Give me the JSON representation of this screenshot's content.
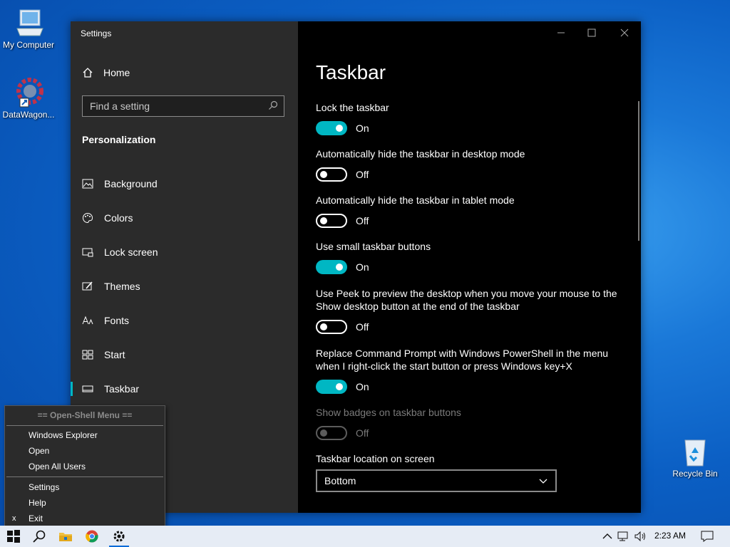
{
  "desktop": {
    "icons": [
      {
        "label": "My Computer",
        "icon": "computer-icon"
      },
      {
        "label": "DataWagon...",
        "icon": "gear-shortcut-icon"
      },
      {
        "label": "Recycle Bin",
        "icon": "recycle-bin-icon"
      }
    ]
  },
  "window": {
    "title": "Settings",
    "controls": [
      "minimize-icon",
      "maximize-icon",
      "close-icon"
    ]
  },
  "sidebar": {
    "home_label": "Home",
    "search_placeholder": "Find a setting",
    "section_title": "Personalization",
    "items": [
      {
        "label": "Background",
        "icon": "picture-icon"
      },
      {
        "label": "Colors",
        "icon": "palette-icon"
      },
      {
        "label": "Lock screen",
        "icon": "lock-screen-icon"
      },
      {
        "label": "Themes",
        "icon": "brush-icon"
      },
      {
        "label": "Fonts",
        "icon": "font-icon"
      },
      {
        "label": "Start",
        "icon": "start-grid-icon"
      },
      {
        "label": "Taskbar",
        "icon": "taskbar-icon",
        "active": true
      }
    ]
  },
  "content": {
    "title": "Taskbar",
    "settings": [
      {
        "label": "Lock the taskbar",
        "state": "On"
      },
      {
        "label": "Automatically hide the taskbar in desktop mode",
        "state": "Off"
      },
      {
        "label": "Automatically hide the taskbar in tablet mode",
        "state": "Off"
      },
      {
        "label": "Use small taskbar buttons",
        "state": "On"
      },
      {
        "label_line1": "Use Peek to preview the desktop when you move your mouse to the",
        "label_line2": "Show desktop button at the end of the taskbar",
        "state": "Off"
      },
      {
        "label_line1": "Replace Command Prompt with Windows PowerShell in the menu",
        "label_line2": "when I right-click the start button or press Windows key+X",
        "state": "On"
      },
      {
        "label": "Show badges on taskbar buttons",
        "state": "Off",
        "disabled": true
      }
    ],
    "location_label": "Taskbar location on screen",
    "location_value": "Bottom"
  },
  "context_menu": {
    "header": "== Open-Shell Menu ==",
    "items": [
      "Windows Explorer",
      "Open",
      "Open All Users",
      "Settings",
      "Help",
      "Exit"
    ],
    "exit_marker": "x"
  },
  "taskbar": {
    "clock": "2:23 AM",
    "accent": "#0a6bd8"
  },
  "colors": {
    "accent_toggle": "#00b7c3",
    "sidebar_bg": "#2b2b2b",
    "content_bg": "#000000"
  }
}
